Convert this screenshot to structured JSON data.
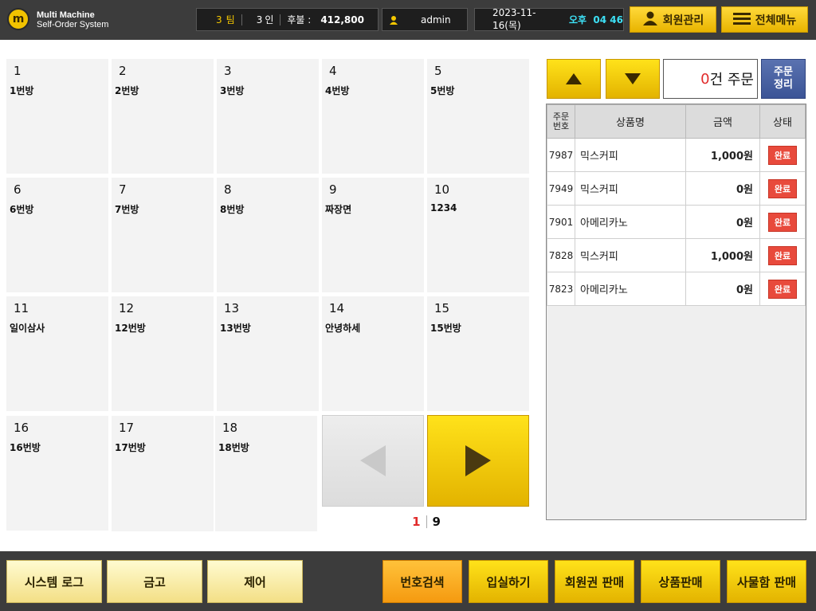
{
  "header": {
    "logo_mark": "m",
    "brand_title": "Multi Machine",
    "brand_subtitle": "Self-Order System",
    "team_count": "3",
    "team_unit": "팀",
    "people_count": "3",
    "people_unit": "인",
    "deferred_label": "후불 :",
    "deferred_amount": "412,800",
    "user_name": "admin",
    "date": "2023-11-16(목)",
    "time": "오후  04 46",
    "member_mgmt_label": "회원관리",
    "full_menu_label": "전체메뉴"
  },
  "rooms": [
    {
      "num": "1",
      "name": "1번방"
    },
    {
      "num": "2",
      "name": "2번방"
    },
    {
      "num": "3",
      "name": "3번방"
    },
    {
      "num": "4",
      "name": "4번방"
    },
    {
      "num": "5",
      "name": "5번방"
    },
    {
      "num": "6",
      "name": "6번방"
    },
    {
      "num": "7",
      "name": "7번방"
    },
    {
      "num": "8",
      "name": "8번방"
    },
    {
      "num": "9",
      "name": "짜장면"
    },
    {
      "num": "10",
      "name": "1234"
    },
    {
      "num": "11",
      "name": "일이삼사"
    },
    {
      "num": "12",
      "name": "12번방"
    },
    {
      "num": "13",
      "name": "13번방"
    },
    {
      "num": "14",
      "name": "안녕하세"
    },
    {
      "num": "15",
      "name": "15번방"
    },
    {
      "num": "16",
      "name": "16번방"
    },
    {
      "num": "17",
      "name": "17번방"
    },
    {
      "num": "18",
      "name": "18번방"
    }
  ],
  "pager": {
    "current": "1",
    "total": "9"
  },
  "orders_panel": {
    "count": "0",
    "count_suffix": "건 주문",
    "tidy_line1": "주문",
    "tidy_line2": "정리",
    "columns": [
      "주문\n번호",
      "상품명",
      "금액",
      "상태"
    ],
    "col_no_line1": "주문",
    "col_no_line2": "번호",
    "rows": [
      {
        "no": "7987",
        "product": "믹스커피",
        "amount": "1,000원",
        "status": "완료"
      },
      {
        "no": "7949",
        "product": "믹스커피",
        "amount": "0원",
        "status": "완료"
      },
      {
        "no": "7901",
        "product": "아메리카노",
        "amount": "0원",
        "status": "완료"
      },
      {
        "no": "7828",
        "product": "믹스커피",
        "amount": "1,000원",
        "status": "완료"
      },
      {
        "no": "7823",
        "product": "아메리카노",
        "amount": "0원",
        "status": "완료"
      }
    ]
  },
  "footer": {
    "system_log": "시스템 로그",
    "safe": "금고",
    "control": "제어",
    "number_search": "번호검색",
    "check_in": "입실하기",
    "membership_sale": "회원권 판매",
    "product_sale": "상품판매",
    "locker_sale": "사물함 판매"
  },
  "colors": {
    "topbar_bg": "#3c3c3c",
    "accent_yellow": "#f5c800",
    "accent_red": "#e12b2b",
    "tidy_blue": "#3b5496",
    "time_cyan": "#3de0f5"
  },
  "icons": [
    "logo-icon",
    "user-icon",
    "person-icon",
    "menu-icon",
    "up-arrow-icon",
    "down-arrow-icon",
    "prev-icon",
    "next-icon"
  ]
}
